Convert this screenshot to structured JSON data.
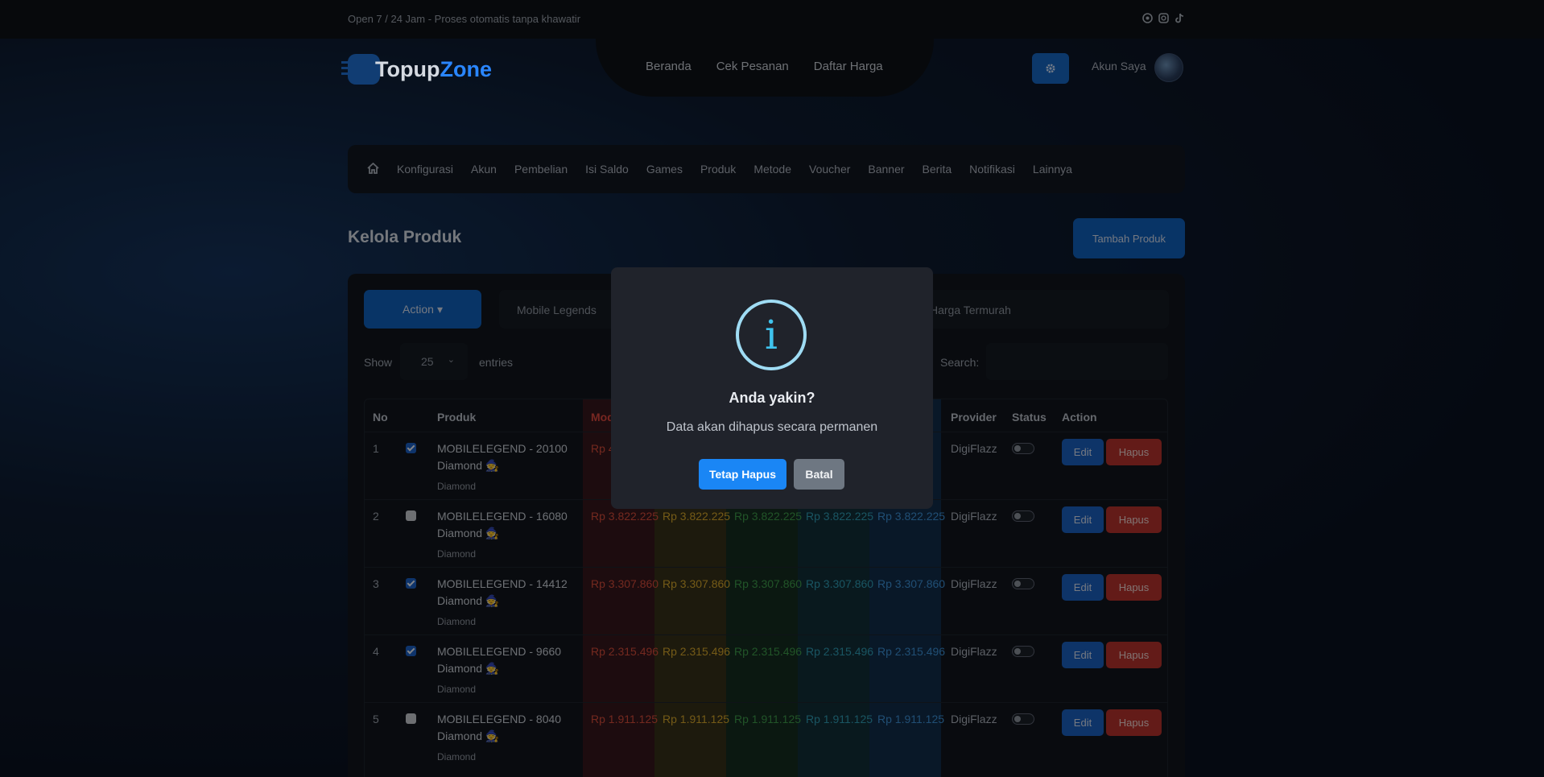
{
  "topbar": {
    "text": "Open 7 / 24 Jam - Proses otomatis tanpa khawatir"
  },
  "logo": {
    "part1": "Topup",
    "part2": "Zone"
  },
  "mainnav": [
    "Beranda",
    "Cek Pesanan",
    "Daftar Harga"
  ],
  "account": {
    "label": "Akun Saya"
  },
  "adminnav": [
    "Konfigurasi",
    "Akun",
    "Pembelian",
    "Isi Saldo",
    "Games",
    "Produk",
    "Metode",
    "Voucher",
    "Banner",
    "Berita",
    "Notifikasi",
    "Lainnya"
  ],
  "page": {
    "title": "Kelola Produk",
    "add_button": "Tambah Produk"
  },
  "toolbar": {
    "action_label": "Action",
    "game_filter": "Mobile Legends",
    "sort_filter": "Harga Termurah"
  },
  "entries": {
    "show": "Show",
    "value": "25",
    "suffix": "entries"
  },
  "search": {
    "label": "Search:",
    "value": ""
  },
  "table": {
    "headers": {
      "no": "No",
      "produk": "Produk",
      "modal": "Mod",
      "provider": "Provider",
      "status": "Status",
      "action": "Action"
    },
    "edit_label": "Edit",
    "delete_label": "Hapus",
    "rows": [
      {
        "no": "1",
        "checked": true,
        "name": "MOBILELEGEND - 20100 Diamond 🧙",
        "sub": "Diamond",
        "prices": [
          "Rp 4.77"
        ],
        "provider": "DigiFlazz"
      },
      {
        "no": "2",
        "checked": false,
        "name": "MOBILELEGEND - 16080 Diamond 🧙",
        "sub": "Diamond",
        "prices": [
          "Rp 3.822.225",
          "Rp 3.822.225",
          "Rp 3.822.225",
          "Rp 3.822.225",
          "Rp 3.822.225"
        ],
        "provider": "DigiFlazz"
      },
      {
        "no": "3",
        "checked": true,
        "name": "MOBILELEGEND - 14412 Diamond 🧙",
        "sub": "Diamond",
        "prices": [
          "Rp 3.307.860",
          "Rp 3.307.860",
          "Rp 3.307.860",
          "Rp 3.307.860",
          "Rp 3.307.860"
        ],
        "provider": "DigiFlazz"
      },
      {
        "no": "4",
        "checked": true,
        "name": "MOBILELEGEND - 9660 Diamond 🧙",
        "sub": "Diamond",
        "prices": [
          "Rp 2.315.496",
          "Rp 2.315.496",
          "Rp 2.315.496",
          "Rp 2.315.496",
          "Rp 2.315.496"
        ],
        "provider": "DigiFlazz"
      },
      {
        "no": "5",
        "checked": false,
        "name": "MOBILELEGEND - 8040 Diamond 🧙",
        "sub": "Diamond",
        "prices": [
          "Rp 1.911.125",
          "Rp 1.911.125",
          "Rp 1.911.125",
          "Rp 1.911.125",
          "Rp 1.911.125"
        ],
        "provider": "DigiFlazz"
      }
    ]
  },
  "modal": {
    "icon": "info-icon",
    "icon_glyph": "i",
    "title": "Anda yakin?",
    "text": "Data akan dihapus secara permanen",
    "confirm": "Tetap Hapus",
    "cancel": "Batal"
  },
  "colors": {
    "primary": "#0f5fbb",
    "danger": "#b5322c",
    "confirm": "#1a86f5",
    "info_ring": "#9fdcf4"
  }
}
